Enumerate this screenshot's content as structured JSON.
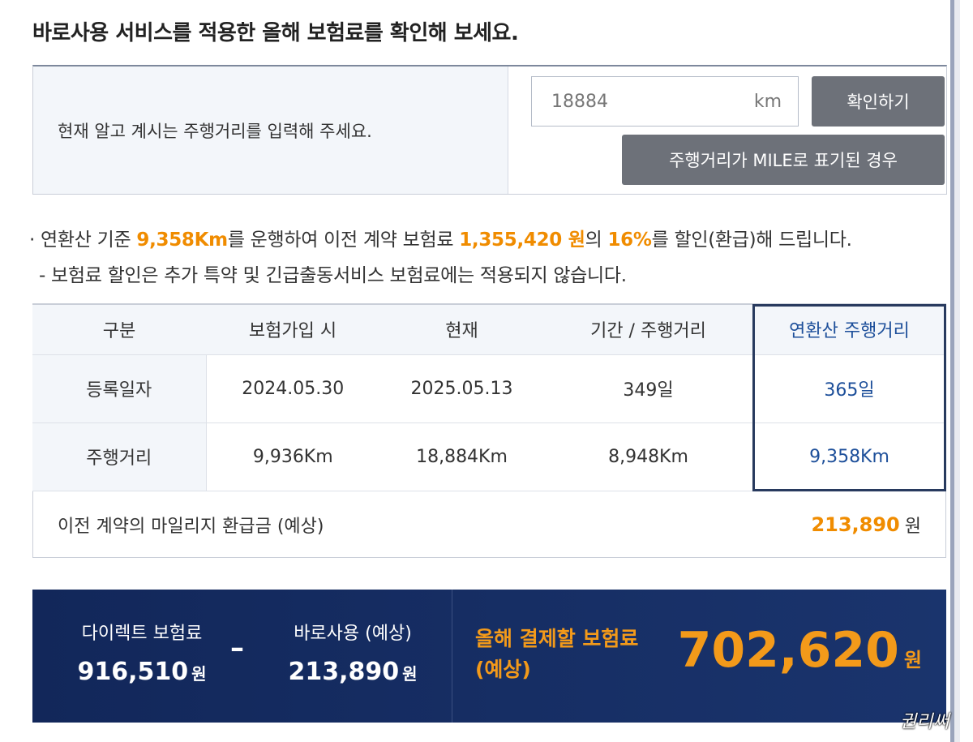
{
  "title": "바로사용 서비스를 적용한 올해 보험료를 확인해 보세요.",
  "input": {
    "prompt": "현재 알고 계시는 주행거리를 입력해 주세요.",
    "value": "18884",
    "unit": "km",
    "confirm_button": "확인하기",
    "mile_button": "주행거리가 MILE로 표기된 경우"
  },
  "notice": {
    "line1_pre": "연환산 기준 ",
    "distance": "9,358Km",
    "line1_mid1": "를 운행하여 이전 계약 보험료 ",
    "premium": "1,355,420 원",
    "line1_mid2": "의 ",
    "percent": "16%",
    "line1_post": "를 할인(환급)해 드립니다.",
    "line2": "보험료 할인은 추가 특약 및 긴급출동서비스 보험료에는 적용되지 않습니다."
  },
  "table": {
    "headers": [
      "구분",
      "보험가입 시",
      "현재",
      "기간 / 주행거리",
      "연환산 주행거리"
    ],
    "rows": [
      [
        "등록일자",
        "2024.05.30",
        "2025.05.13",
        "349일",
        "365일"
      ],
      [
        "주행거리",
        "9,936Km",
        "18,884Km",
        "8,948Km",
        "9,358Km"
      ]
    ],
    "refund_label": "이전 계약의 마일리지 환급금 (예상)",
    "refund_amount": "213,890",
    "refund_unit": "원"
  },
  "summary": {
    "direct_label": "다이렉트 보험료",
    "direct_amount": "916,510",
    "minus": "–",
    "baro_label": "바로사용 (예상)",
    "baro_amount": "213,890",
    "won": "원",
    "pay_label_1": "올해 결제할 보험료",
    "pay_label_2": "(예상)",
    "pay_amount": "702,620"
  },
  "signature": "권리써"
}
